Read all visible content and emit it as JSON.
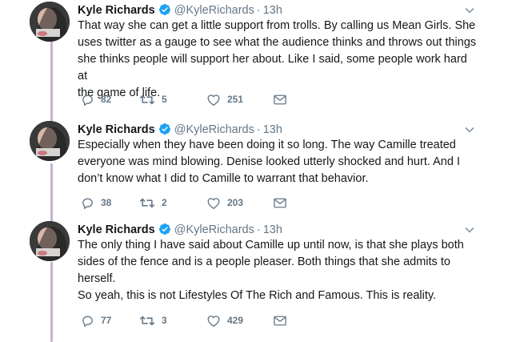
{
  "tweets": [
    {
      "name": "Kyle Richards",
      "handle": "@KyleRichards",
      "time": "13h",
      "lines": [
        "That way she can get a little support from trolls. By calling us Mean Girls. She",
        "uses twitter as a gauge to see what the audience thinks and throws out things",
        "she thinks people will support her about. Like I said, some people work  hard at",
        "the game of life."
      ],
      "replies": "82",
      "retweets": "5",
      "likes": "251"
    },
    {
      "name": "Kyle Richards",
      "handle": "@KyleRichards",
      "time": "13h",
      "lines": [
        "Especially when they have been doing it so long. The way Camille treated",
        "everyone was mind blowing. Denise looked utterly shocked and hurt. And I",
        "don’t know what I did to Camille to warrant that behavior."
      ],
      "replies": "38",
      "retweets": "2",
      "likes": "203"
    },
    {
      "name": "Kyle Richards",
      "handle": "@KyleRichards",
      "time": "13h",
      "lines": [
        "The only thing I have said about Camille up until now, is that she plays both",
        "sides of the fence and is a people pleaser. Both things that she admits to",
        "herself.",
        "So yeah, this is not Lifestyles Of The Rich and Famous. This is reality."
      ],
      "replies": "77",
      "retweets": "3",
      "likes": "429"
    }
  ],
  "icons": {
    "verified": "verified-badge-icon",
    "reply": "reply-icon",
    "retweet": "retweet-icon",
    "like": "heart-icon",
    "dm": "envelope-icon",
    "caret": "chevron-down-icon"
  },
  "colors": {
    "thread_line": "#c6b2d6",
    "verified": "#1da1f2",
    "muted": "#657786",
    "text": "#14171a"
  }
}
